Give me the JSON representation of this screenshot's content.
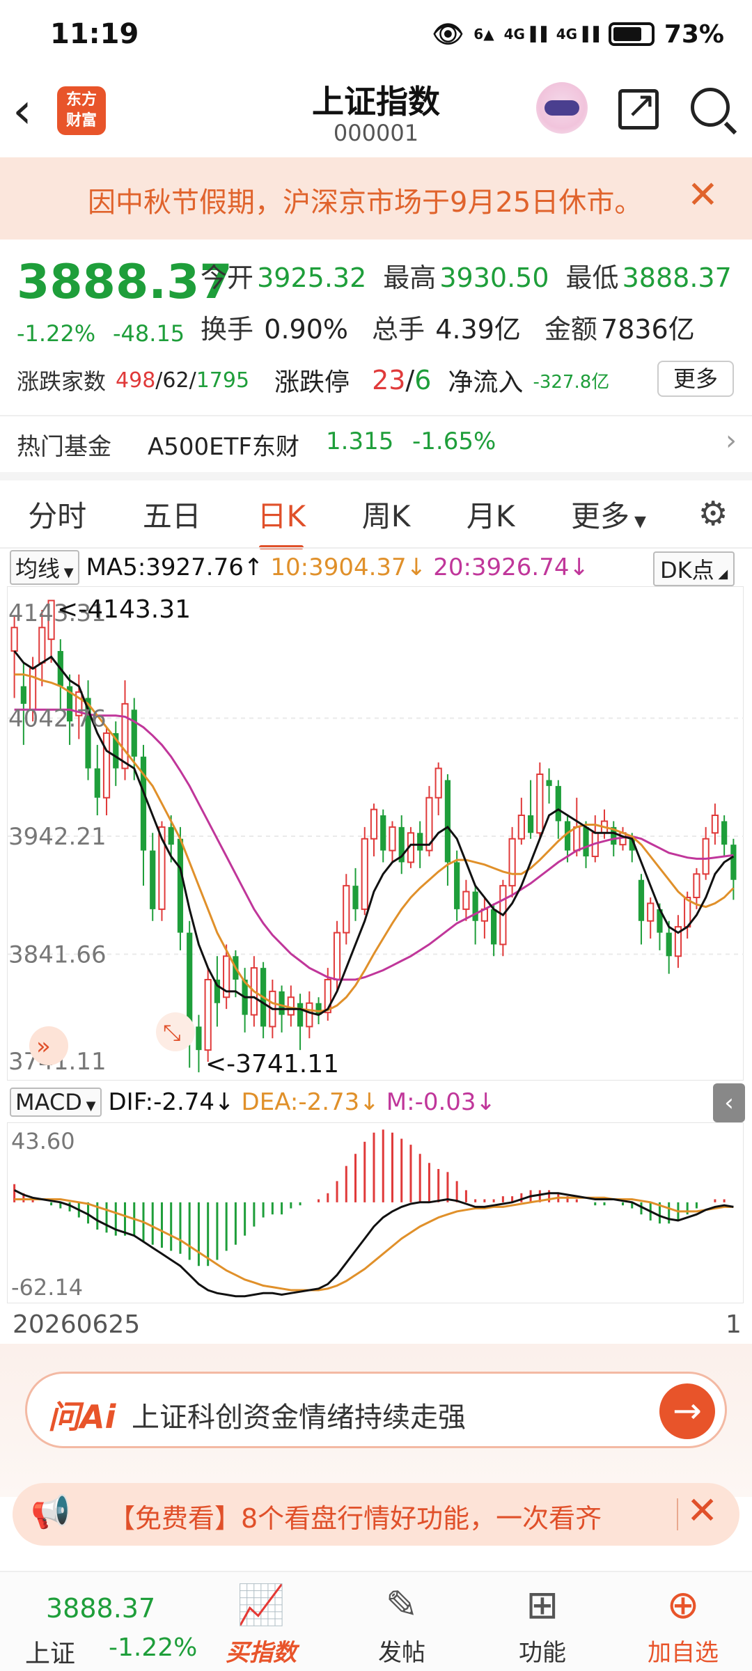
{
  "status": {
    "time": "11:19",
    "battery": "73%",
    "signal1": "4G",
    "signal2": "4G",
    "wifi_badge": "6"
  },
  "header": {
    "logo_line1": "东方",
    "logo_line2": "财富",
    "title": "上证指数",
    "code": "000001"
  },
  "notice": {
    "text": "因中秋节假期，沪深京市场于9月25日休市。"
  },
  "quote": {
    "price": "3888.37",
    "pct": "-1.22%",
    "chg": "-48.15",
    "open_label": "今开",
    "open": "3925.32",
    "high_label": "最高",
    "high": "3930.50",
    "low_label": "最低",
    "low": "3888.37",
    "turnover_label": "换手",
    "turnover": "0.90%",
    "volume_label": "总手",
    "volume": "4.39亿",
    "amount_label": "金额",
    "amount": "7836亿",
    "breadth_label": "涨跌家数",
    "breadth_up": "498",
    "breadth_flat": "62",
    "breadth_down": "1795",
    "limit_label": "涨跌停",
    "limit_up": "23",
    "limit_down": "6",
    "netflow_label": "净流入",
    "netflow": "-327.8亿",
    "more": "更多"
  },
  "hotfund": {
    "label": "热门基金",
    "name": "A500ETF东财",
    "price": "1.315",
    "change": "-1.65%"
  },
  "tabs": [
    "分时",
    "五日",
    "日K",
    "周K",
    "月K",
    "更多"
  ],
  "active_tab": 2,
  "ma": {
    "selector": "均线",
    "ma5": "MA5:3927.76↑",
    "ma10": "10:3904.37↓",
    "ma20": "20:3926.74↓",
    "dk": "DK点"
  },
  "macd": {
    "selector": "MACD",
    "dif": "DIF:-2.74↓",
    "dea": "DEA:-2.73↓",
    "m": "M:-0.03↓"
  },
  "bottom": {
    "price": "3888.37",
    "name": "上证",
    "pct": "-1.22%",
    "buy": "买指数",
    "post": "发帖",
    "func": "功能",
    "add": "加自选"
  },
  "ai": {
    "label": "问Ai",
    "query": "上证科创资金情绪持续走强"
  },
  "promo": {
    "text": "【免费看】8个看盘行情好功能，一次看齐"
  },
  "colors": {
    "up": "#e03a3a",
    "down": "#1e9e3a",
    "ma5": "#111111",
    "ma10": "#e0902a",
    "ma20": "#c0369a",
    "accent": "#e8542a"
  },
  "chart_data": [
    {
      "type": "candlestick",
      "title": "",
      "ylim": [
        3741.11,
        4143.31
      ],
      "y_ticks": [
        "4143.31",
        "4042.76",
        "3942.21",
        "3841.66",
        "3741.11"
      ],
      "annotations": [
        "<-4143.31",
        "<-3741.11"
      ],
      "x_start_label": "20260625",
      "candles": [
        [
          4100,
          4120,
          4060,
          4130
        ],
        [
          4070,
          4055,
          4020,
          4090
        ],
        [
          4050,
          4085,
          4040,
          4095
        ],
        [
          4090,
          4120,
          4070,
          4135
        ],
        [
          4110,
          4143,
          4090,
          4143
        ],
        [
          4100,
          4070,
          4050,
          4110
        ],
        [
          4070,
          4040,
          4020,
          4080
        ],
        [
          4045,
          4065,
          4025,
          4080
        ],
        [
          4060,
          4000,
          3990,
          4075
        ],
        [
          4000,
          3975,
          3960,
          4020
        ],
        [
          3975,
          4030,
          3960,
          4035
        ],
        [
          4030,
          4000,
          3985,
          4040
        ],
        [
          4000,
          4055,
          3990,
          4075
        ],
        [
          4050,
          4010,
          3990,
          4060
        ],
        [
          4010,
          3930,
          3900,
          4020
        ],
        [
          3930,
          3880,
          3870,
          3945
        ],
        [
          3880,
          3950,
          3870,
          3955
        ],
        [
          3950,
          3935,
          3920,
          3960
        ],
        [
          3940,
          3860,
          3845,
          3950
        ],
        [
          3860,
          3775,
          3745,
          3870
        ],
        [
          3780,
          3760,
          3741,
          3790
        ],
        [
          3760,
          3820,
          3750,
          3830
        ],
        [
          3820,
          3800,
          3780,
          3840
        ],
        [
          3805,
          3840,
          3795,
          3850
        ],
        [
          3840,
          3820,
          3805,
          3845
        ],
        [
          3820,
          3790,
          3775,
          3830
        ],
        [
          3790,
          3830,
          3780,
          3840
        ],
        [
          3830,
          3780,
          3770,
          3835
        ],
        [
          3780,
          3810,
          3770,
          3820
        ],
        [
          3810,
          3790,
          3775,
          3815
        ],
        [
          3790,
          3805,
          3780,
          3815
        ],
        [
          3800,
          3780,
          3760,
          3808
        ],
        [
          3780,
          3800,
          3770,
          3810
        ],
        [
          3800,
          3790,
          3782,
          3805
        ],
        [
          3792,
          3820,
          3785,
          3830
        ],
        [
          3820,
          3860,
          3810,
          3870
        ],
        [
          3860,
          3900,
          3850,
          3910
        ],
        [
          3900,
          3880,
          3870,
          3915
        ],
        [
          3880,
          3940,
          3875,
          3950
        ],
        [
          3940,
          3965,
          3925,
          3970
        ],
        [
          3960,
          3930,
          3920,
          3965
        ],
        [
          3930,
          3950,
          3920,
          3955
        ],
        [
          3950,
          3920,
          3910,
          3960
        ],
        [
          3920,
          3945,
          3915,
          3950
        ],
        [
          3945,
          3930,
          3915,
          3955
        ],
        [
          3930,
          3975,
          3925,
          3985
        ],
        [
          3975,
          4000,
          3960,
          4005
        ],
        [
          3990,
          3920,
          3900,
          3995
        ],
        [
          3920,
          3880,
          3870,
          3930
        ],
        [
          3880,
          3895,
          3870,
          3905
        ],
        [
          3895,
          3870,
          3850,
          3900
        ],
        [
          3870,
          3880,
          3855,
          3890
        ],
        [
          3880,
          3850,
          3840,
          3885
        ],
        [
          3850,
          3900,
          3840,
          3905
        ],
        [
          3900,
          3940,
          3890,
          3950
        ],
        [
          3940,
          3960,
          3935,
          3975
        ],
        [
          3960,
          3945,
          3940,
          3990
        ],
        [
          3945,
          3995,
          3940,
          4005
        ],
        [
          3990,
          3985,
          3970,
          4000
        ],
        [
          3985,
          3955,
          3940,
          3990
        ],
        [
          3955,
          3930,
          3920,
          3960
        ],
        [
          3930,
          3950,
          3925,
          3975
        ],
        [
          3950,
          3925,
          3915,
          3955
        ],
        [
          3925,
          3945,
          3920,
          3960
        ],
        [
          3945,
          3955,
          3940,
          3965
        ],
        [
          3950,
          3935,
          3925,
          3955
        ],
        [
          3935,
          3945,
          3930,
          3950
        ],
        [
          3940,
          3930,
          3920,
          3945
        ],
        [
          3905,
          3870,
          3850,
          3910
        ],
        [
          3870,
          3885,
          3855,
          3890
        ],
        [
          3880,
          3860,
          3845,
          3885
        ],
        [
          3860,
          3840,
          3825,
          3870
        ],
        [
          3840,
          3865,
          3830,
          3875
        ],
        [
          3865,
          3890,
          3855,
          3895
        ],
        [
          3890,
          3910,
          3880,
          3915
        ],
        [
          3910,
          3940,
          3905,
          3950
        ],
        [
          3945,
          3960,
          3935,
          3970
        ],
        [
          3955,
          3935,
          3925,
          3960
        ],
        [
          3935,
          3905,
          3888,
          3940
        ]
      ],
      "ma5": [
        4100,
        4090,
        4085,
        4090,
        4095,
        4085,
        4075,
        4070,
        4050,
        4030,
        4015,
        4010,
        4005,
        4000,
        3980,
        3960,
        3940,
        3925,
        3915,
        3880,
        3850,
        3830,
        3815,
        3810,
        3810,
        3805,
        3805,
        3800,
        3795,
        3795,
        3795,
        3795,
        3792,
        3790,
        3795,
        3810,
        3830,
        3850,
        3870,
        3895,
        3910,
        3920,
        3925,
        3935,
        3935,
        3935,
        3945,
        3950,
        3940,
        3920,
        3900,
        3890,
        3880,
        3875,
        3885,
        3900,
        3920,
        3940,
        3960,
        3965,
        3960,
        3955,
        3950,
        3945,
        3945,
        3945,
        3942,
        3940,
        3920,
        3900,
        3880,
        3865,
        3860,
        3865,
        3875,
        3890,
        3910,
        3920,
        3925
      ],
      "ma10": [
        4080,
        4080,
        4078,
        4075,
        4073,
        4070,
        4065,
        4060,
        4055,
        4045,
        4035,
        4025,
        4015,
        4005,
        3995,
        3985,
        3970,
        3955,
        3940,
        3920,
        3900,
        3880,
        3860,
        3845,
        3830,
        3818,
        3810,
        3805,
        3800,
        3798,
        3796,
        3795,
        3794,
        3793,
        3794,
        3798,
        3805,
        3815,
        3828,
        3842,
        3855,
        3868,
        3880,
        3890,
        3898,
        3905,
        3912,
        3918,
        3922,
        3922,
        3920,
        3918,
        3915,
        3912,
        3910,
        3910,
        3915,
        3922,
        3930,
        3938,
        3945,
        3950,
        3952,
        3952,
        3950,
        3948,
        3945,
        3942,
        3935,
        3925,
        3915,
        3905,
        3895,
        3888,
        3884,
        3882,
        3885,
        3890,
        3898
      ],
      "ma20": [
        4050,
        4050,
        4050,
        4050,
        4050,
        4050,
        4050,
        4048,
        4046,
        4045,
        4045,
        4045,
        4044,
        4040,
        4035,
        4028,
        4020,
        4010,
        3998,
        3985,
        3970,
        3955,
        3940,
        3925,
        3910,
        3895,
        3880,
        3868,
        3858,
        3850,
        3842,
        3836,
        3830,
        3826,
        3822,
        3820,
        3820,
        3820,
        3822,
        3825,
        3828,
        3832,
        3836,
        3840,
        3845,
        3850,
        3856,
        3862,
        3868,
        3872,
        3876,
        3880,
        3884,
        3888,
        3892,
        3897,
        3902,
        3908,
        3914,
        3920,
        3925,
        3930,
        3933,
        3936,
        3938,
        3940,
        3941,
        3942,
        3940,
        3936,
        3932,
        3928,
        3926,
        3924,
        3923,
        3923,
        3924,
        3925,
        3926
      ]
    },
    {
      "type": "bar",
      "title": "",
      "ylim": [
        -62.14,
        43.6
      ],
      "y_ticks": [
        "43.60",
        "-62.14"
      ],
      "dif": [
        8,
        5,
        3,
        2,
        1,
        0,
        -2,
        -5,
        -8,
        -12,
        -15,
        -18,
        -20,
        -22,
        -26,
        -30,
        -34,
        -38,
        -42,
        -48,
        -54,
        -58,
        -60,
        -61,
        -62,
        -62,
        -61,
        -60,
        -60,
        -61,
        -60,
        -59,
        -58,
        -57,
        -54,
        -48,
        -40,
        -32,
        -24,
        -16,
        -10,
        -6,
        -3,
        -1,
        0,
        0,
        1,
        2,
        1,
        -1,
        -3,
        -3,
        -2,
        -1,
        0,
        2,
        4,
        5,
        6,
        6,
        5,
        4,
        3,
        2,
        2,
        2,
        1,
        0,
        -3,
        -6,
        -9,
        -11,
        -12,
        -10,
        -8,
        -5,
        -3,
        -2,
        -3
      ],
      "dea": [
        2,
        2,
        2,
        2,
        2,
        2,
        1,
        0,
        -1,
        -3,
        -5,
        -7,
        -9,
        -11,
        -13,
        -16,
        -19,
        -22,
        -25,
        -29,
        -33,
        -37,
        -41,
        -45,
        -48,
        -51,
        -53,
        -55,
        -56,
        -57,
        -58,
        -58,
        -58,
        -58,
        -57,
        -55,
        -52,
        -48,
        -44,
        -39,
        -34,
        -29,
        -24,
        -20,
        -16,
        -13,
        -10,
        -8,
        -6,
        -5,
        -4,
        -4,
        -3,
        -3,
        -2,
        -1,
        0,
        1,
        2,
        3,
        3,
        3,
        3,
        3,
        3,
        2,
        2,
        2,
        1,
        0,
        -2,
        -4,
        -6,
        -6,
        -6,
        -5,
        -4,
        -3,
        -3
      ],
      "macd": [
        12,
        6,
        2,
        0,
        -2,
        -4,
        -6,
        -10,
        -14,
        -18,
        -20,
        -22,
        -22,
        -22,
        -26,
        -28,
        -30,
        -32,
        -34,
        -38,
        -42,
        -42,
        -38,
        -32,
        -28,
        -22,
        -16,
        -10,
        -8,
        -8,
        -4,
        -2,
        0,
        2,
        6,
        14,
        24,
        32,
        40,
        46,
        48,
        46,
        42,
        38,
        32,
        26,
        22,
        20,
        14,
        8,
        2,
        2,
        2,
        4,
        4,
        6,
        8,
        8,
        8,
        6,
        4,
        2,
        0,
        -2,
        -2,
        0,
        -2,
        -4,
        -8,
        -12,
        -14,
        -14,
        -12,
        -8,
        -4,
        0,
        2,
        2,
        0
      ]
    }
  ]
}
